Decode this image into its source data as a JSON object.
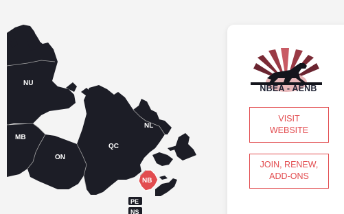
{
  "map": {
    "provinces": {
      "nu": "NU",
      "mb": "MB",
      "on": "ON",
      "qc": "QC",
      "nl": "NL",
      "nb": "NB",
      "pe": "PE",
      "ns": "NS"
    },
    "colors": {
      "land": "#1c1d26",
      "border": "#a8a8a8",
      "highlight": "#e24c4f",
      "background": "#f4f4f4"
    }
  },
  "card": {
    "logo_text": "NBEA - AÉNB",
    "visit_button": [
      "VISIT",
      "WEBSITE"
    ],
    "join_button": [
      "JOIN, RENEW,",
      "ADD-ONS"
    ],
    "accent_color": "#e24c4f"
  }
}
